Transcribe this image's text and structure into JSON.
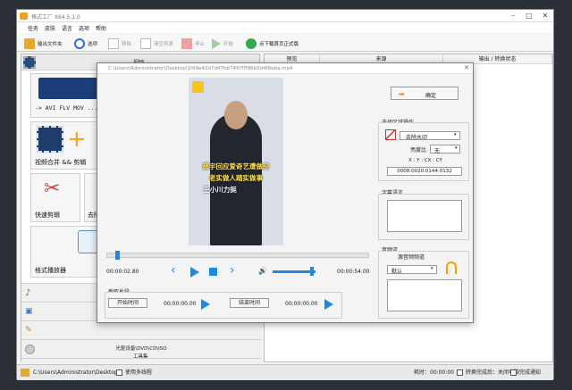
{
  "window": {
    "title": "格式工厂 X64 5.1.0"
  },
  "menu": [
    "任务",
    "皮肤",
    "语言",
    "选项",
    "帮助"
  ],
  "toolbar": {
    "output_folder": "输出文件夹",
    "options": "选项",
    "remove": "移除",
    "clear_list": "清空列表",
    "stop": "停止",
    "start": "开始",
    "download": "点下载首页正式版"
  },
  "left_panel": {
    "header": "视频",
    "format_row": "-> AVI FLV MOV ....",
    "card_merge": "视频合并 && 剪辑",
    "card_quick_cut": "快速剪辑",
    "card_remove": "去除",
    "card_player": "格式播放器",
    "categories": [
      "光驱设备\\DVD\\CD\\ISO",
      "工具集"
    ]
  },
  "right_panel": {
    "columns": [
      "预览",
      "来源",
      "输出 / 转换状态"
    ]
  },
  "status_bar": {
    "path": "C:\\Users\\Administrator\\Desktop",
    "multithread": "使用多线程",
    "elapsed": "耗时：00:00:00",
    "shutdown": "转换完成后：关闭电脑",
    "notify": "完成通知"
  },
  "dialog": {
    "title": "C:\\Users\\Administrator\\Desktop\\1fd9e42d7d47bb745f7ff96b5d4f8eba.mp4",
    "video_caption": [
      "龚宇回应爱奇艺遭做空",
      "老实做人踏实做事",
      "王小川力挺"
    ],
    "ok_label": "确定",
    "crop_group": "选择区域操作",
    "remove_watermark": "去除水印",
    "brightness_label": "亮度比",
    "brightness_value": "无",
    "coords_label": "X : Y : CX : CY",
    "coords_value": "0008:0020:0144:0132",
    "subtitle_group": "字幕语言",
    "audio_group": "音频流",
    "audio_channel_label": "源音频频道",
    "audio_channel_value": "默认",
    "time_start": "00:00:02.80",
    "time_end": "00:00:54.00",
    "clip_group": "截取片段",
    "start_time_btn": "开始时间",
    "start_time_value": "00:00:00.00",
    "end_time_btn": "结束时间",
    "end_time_value": "00:00:00.00",
    "playback_progress": 0.03,
    "volume_level": 0.95
  }
}
